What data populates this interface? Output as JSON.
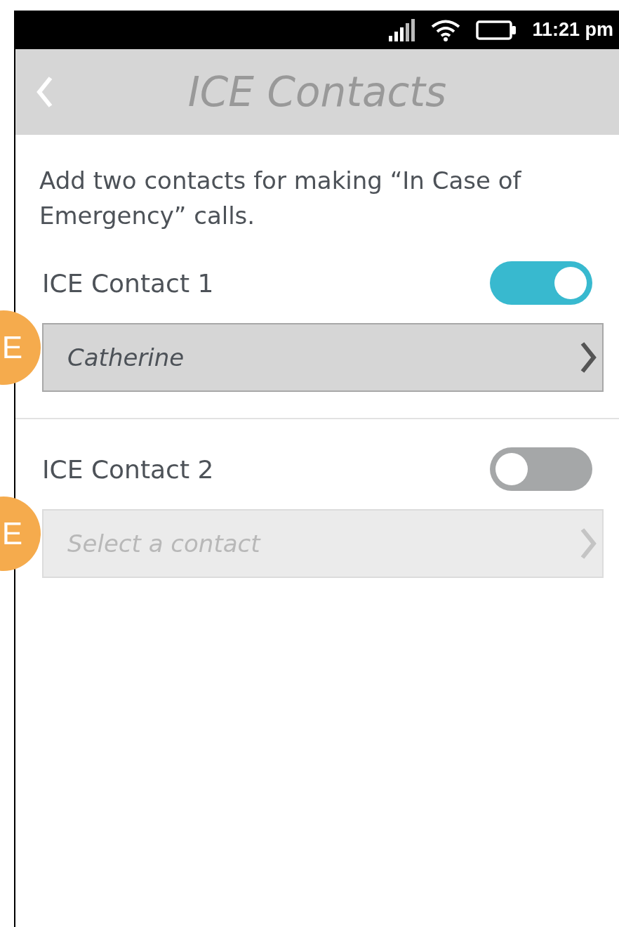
{
  "status_bar": {
    "time": "11:21 pm"
  },
  "header": {
    "title": "ICE Contacts"
  },
  "intro": "Add two contacts for making “In Case of Emergency” calls.",
  "contacts": [
    {
      "label": "ICE Contact 1",
      "on": true,
      "value": "Catherine",
      "disabled": false,
      "marker": "E"
    },
    {
      "label": "ICE Contact 2",
      "on": false,
      "placeholder": "Select a contact",
      "disabled": true,
      "marker": "E"
    }
  ]
}
